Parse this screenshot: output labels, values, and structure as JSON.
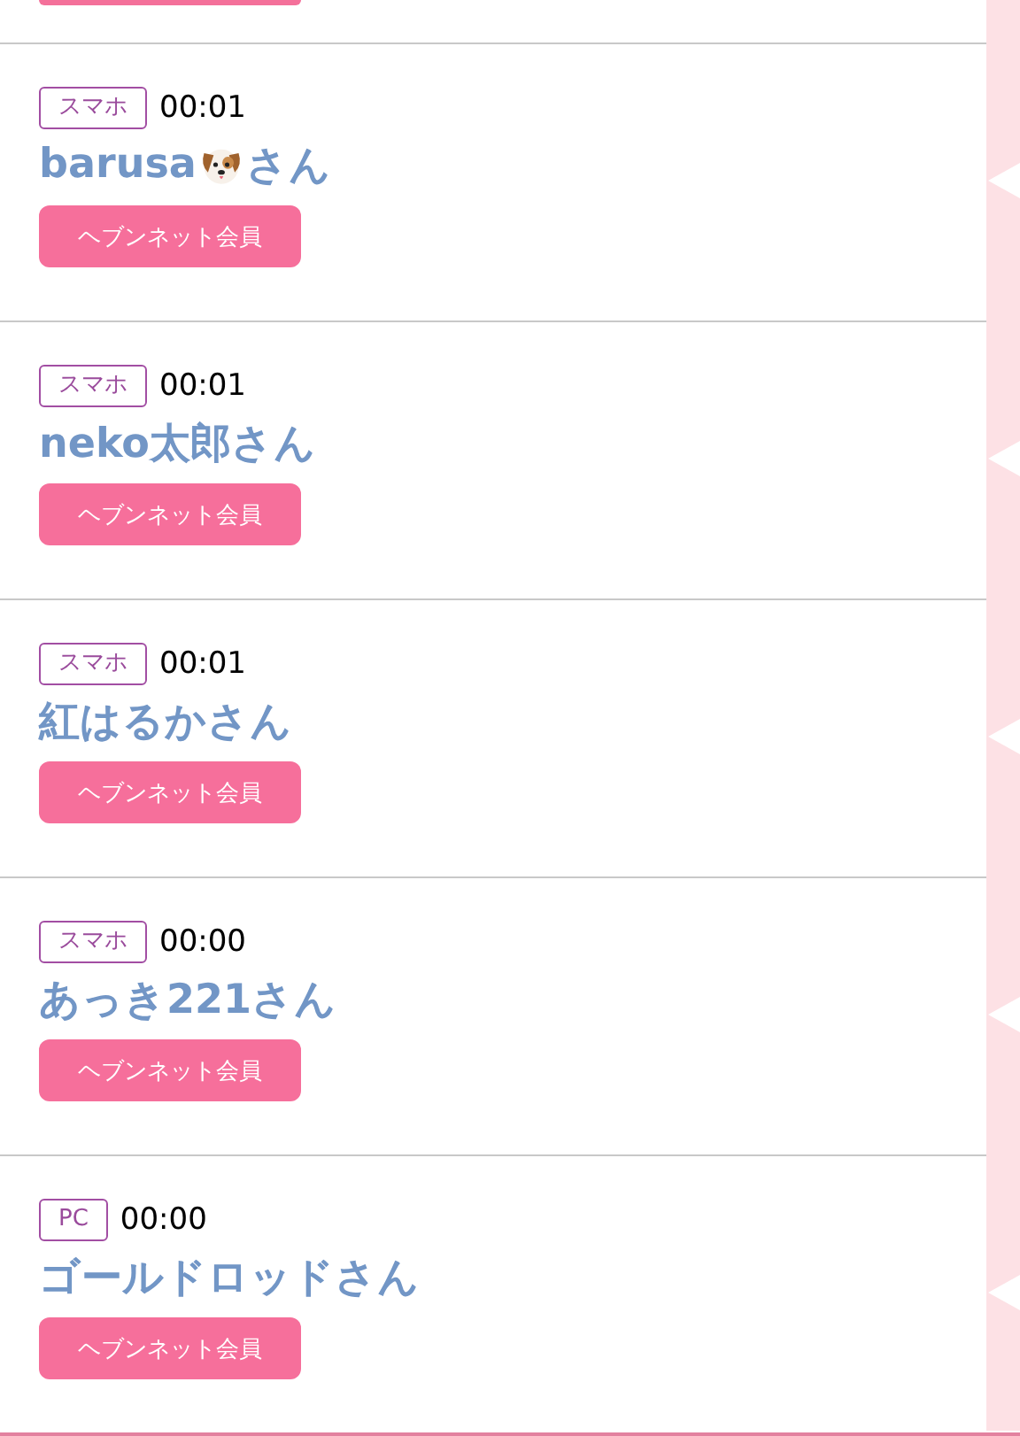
{
  "entries": [
    {
      "kind": "icon",
      "device": "スマホ",
      "time": "00:01",
      "name": "barusa",
      "honorific": "さん",
      "badge": "ヘブンネット会員"
    },
    {
      "kind": "plain",
      "device": "スマホ",
      "time": "00:01",
      "name": "neko太郎",
      "honorific": "さん",
      "badge": "ヘブンネット会員"
    },
    {
      "kind": "plain",
      "device": "スマホ",
      "time": "00:01",
      "name": "紅はるか",
      "honorific": "さん",
      "badge": "ヘブンネット会員"
    },
    {
      "kind": "plain",
      "device": "スマホ",
      "time": "00:00",
      "name": "あっき221",
      "honorific": "さん",
      "badge": "ヘブンネット会員"
    },
    {
      "kind": "plain",
      "device": "PC",
      "time": "00:00",
      "name": "ゴールドロッド",
      "honorific": "さん",
      "badge": "ヘブンネット会員"
    }
  ]
}
